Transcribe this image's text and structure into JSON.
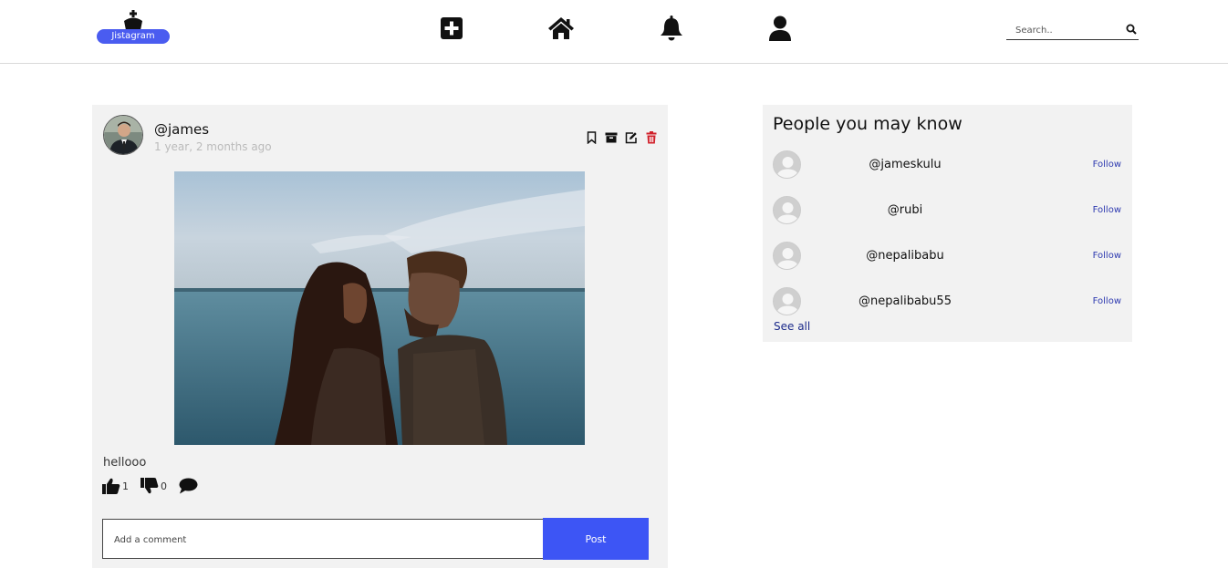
{
  "header": {
    "logo_text": "Jistagram",
    "search_placeholder": "Search.."
  },
  "post": {
    "username": "@james",
    "time_ago": "1 year, 2 months ago",
    "caption": "hellooo",
    "likes": "1",
    "dislikes": "0",
    "comment_placeholder": "Add a comment",
    "post_button": "Post"
  },
  "suggestions": {
    "title": "People you may know",
    "users": [
      {
        "name": "@jameskulu",
        "follow": "Follow"
      },
      {
        "name": "@rubi",
        "follow": "Follow"
      },
      {
        "name": "@nepalibabu",
        "follow": "Follow"
      },
      {
        "name": "@nepalibabu55",
        "follow": "Follow"
      }
    ],
    "see_all": "See all"
  },
  "colors": {
    "accent": "#3d55f5",
    "delete": "#d0202a",
    "link": "#2e3ab0"
  }
}
